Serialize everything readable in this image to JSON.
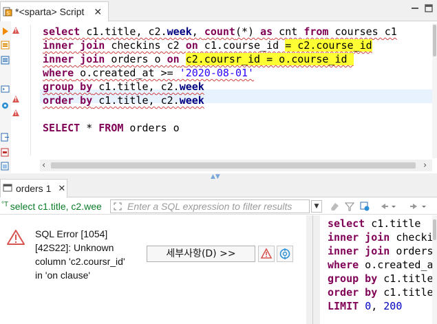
{
  "editor_tab": {
    "title": "*<sparta> Script",
    "close": "✕"
  },
  "editor": {
    "lines": [
      [
        {
          "t": "select",
          "c": "kw",
          "s": true
        },
        {
          "t": " c1.title, c2.",
          "c": "id",
          "s": true
        },
        {
          "t": "week",
          "c": "kwb",
          "s": true
        },
        {
          "t": ", ",
          "c": "id",
          "s": true
        },
        {
          "t": "count",
          "c": "kw",
          "s": true
        },
        {
          "t": "(*) ",
          "c": "id",
          "s": true
        },
        {
          "t": "as",
          "c": "kw",
          "s": true
        },
        {
          "t": " cnt ",
          "c": "id",
          "s": true
        },
        {
          "t": "from",
          "c": "kw",
          "s": true
        },
        {
          "t": " courses c1",
          "c": "id",
          "s": true
        }
      ],
      [
        {
          "t": "inner join",
          "c": "kw",
          "s": true
        },
        {
          "t": " checkins c2 ",
          "c": "id",
          "s": true
        },
        {
          "t": "on",
          "c": "kw",
          "s": true
        },
        {
          "t": " c1.course_id ",
          "c": "id",
          "s": true
        },
        {
          "t": "= c2.course_id",
          "c": "id",
          "s": true,
          "h": true
        }
      ],
      [
        {
          "t": "inner join",
          "c": "kw",
          "s": true
        },
        {
          "t": " orders o ",
          "c": "id",
          "s": true
        },
        {
          "t": "on",
          "c": "kw",
          "s": true
        },
        {
          "t": " ",
          "c": "id",
          "s": true
        },
        {
          "t": "c2.coursr_id = o.course_id ",
          "c": "id",
          "s": true,
          "h": true
        }
      ],
      [
        {
          "t": "where",
          "c": "kw",
          "s": true
        },
        {
          "t": " o.created_at >= ",
          "c": "id",
          "s": true
        },
        {
          "t": "'2020-08-01'",
          "c": "str",
          "s": true
        }
      ],
      [
        {
          "t": "group by",
          "c": "kw",
          "s": true
        },
        {
          "t": " c1.title, c2.",
          "c": "id",
          "s": true
        },
        {
          "t": "week",
          "c": "kwb",
          "s": true
        }
      ],
      [
        {
          "t": "order by",
          "c": "kw",
          "s": true
        },
        {
          "t": " c1.title, c2.",
          "c": "id",
          "s": true
        },
        {
          "t": "week",
          "c": "kwb",
          "s": true
        }
      ],
      [],
      [
        {
          "t": "SELECT",
          "c": "kw"
        },
        {
          "t": " * ",
          "c": "id"
        },
        {
          "t": "FROM",
          "c": "kw"
        },
        {
          "t": " orders o",
          "c": "id"
        }
      ]
    ]
  },
  "results_tab": {
    "label": "orders 1",
    "close": "✕"
  },
  "filter": {
    "query_label": "select c1.title, c2.wee",
    "placeholder": "Enter a SQL expression to filter results"
  },
  "error": {
    "message": "SQL Error [1054]\n[42S22]: Unknown\ncolumn 'c2.coursr_id'\nin 'on clause'",
    "details_button": "세부사항(D) >>"
  },
  "sql_preview": {
    "lines": [
      [
        {
          "t": "select",
          "c": "kw"
        },
        {
          "t": " c1.title",
          "c": "id"
        }
      ],
      [
        {
          "t": "inner join",
          "c": "kw"
        },
        {
          "t": " checkins",
          "c": "id"
        }
      ],
      [
        {
          "t": "inner join",
          "c": "kw"
        },
        {
          "t": " orders",
          "c": "id"
        }
      ],
      [
        {
          "t": "where",
          "c": "kw"
        },
        {
          "t": " o.created_at",
          "c": "id"
        }
      ],
      [
        {
          "t": "group by",
          "c": "kw"
        },
        {
          "t": " c1.title",
          "c": "id"
        }
      ],
      [
        {
          "t": "order by",
          "c": "kw"
        },
        {
          "t": " c1.title",
          "c": "id"
        }
      ],
      [
        {
          "t": "LIMIT",
          "c": "kw"
        },
        {
          "t": " ",
          "c": "id"
        },
        {
          "t": "0",
          "c": "num"
        },
        {
          "t": ", ",
          "c": "id"
        },
        {
          "t": "200",
          "c": "num"
        }
      ]
    ]
  },
  "colors": {
    "keyword": "#7f0055",
    "string": "#2a00ff",
    "highlight": "#ffff33",
    "error": "#d9534f"
  },
  "icons": [
    "script-tab-icon",
    "maximize-icon",
    "minimize-icon",
    "warning-icon",
    "error-icon",
    "filter-icon",
    "results-tab-icon"
  ]
}
